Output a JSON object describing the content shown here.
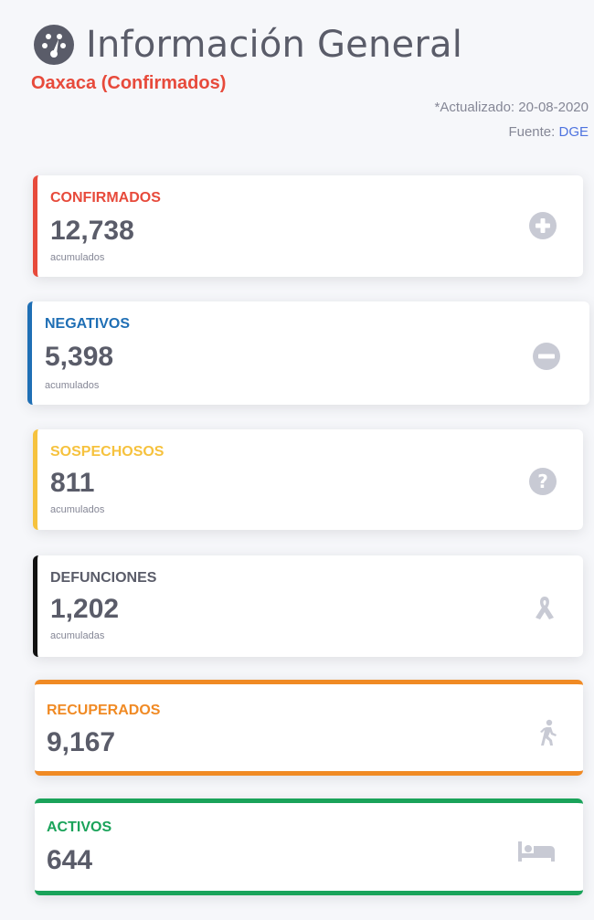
{
  "header": {
    "title": "Información General",
    "subtitle": "Oaxaca (Confirmados)",
    "updated": "*Actualizado: 20-08-2020",
    "source_label": "Fuente: ",
    "source": "DGE"
  },
  "cards": [
    {
      "label": "CONFIRMADOS",
      "value": "12,738",
      "note": "acumulados",
      "icon": "plus-circle-icon",
      "color": "#e74a3b"
    },
    {
      "label": "NEGATIVOS",
      "value": "5,398",
      "note": "acumulados",
      "icon": "minus-circle-icon",
      "color": "#1f6fb5"
    },
    {
      "label": "SOSPECHOSOS",
      "value": "811",
      "note": "acumulados",
      "icon": "question-circle-icon",
      "color": "#f6c23e"
    },
    {
      "label": "DEFUNCIONES",
      "value": "1,202",
      "note": "acumuladas",
      "icon": "ribbon-icon",
      "color": "#111111"
    },
    {
      "label": "RECUPERADOS",
      "value": "9,167",
      "note": "",
      "icon": "walking-person-icon",
      "color": "#f08a24"
    },
    {
      "label": "ACTIVOS",
      "value": "644",
      "note": "",
      "icon": "bed-icon",
      "color": "#1aa35a"
    }
  ]
}
